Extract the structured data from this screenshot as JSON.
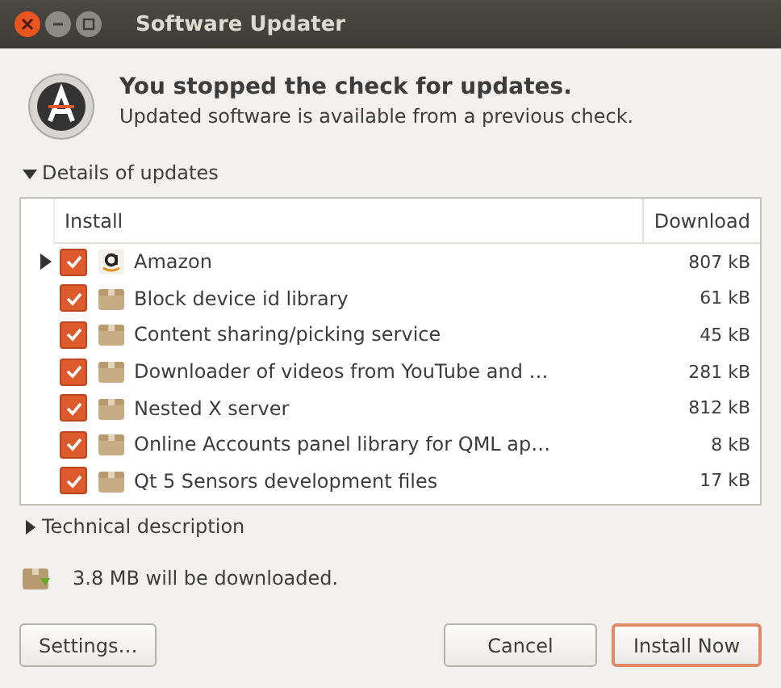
{
  "window": {
    "title": "Software Updater"
  },
  "header": {
    "heading": "You stopped the check for updates.",
    "subtitle": "Updated software is available from a previous check."
  },
  "details": {
    "label": "Details of updates",
    "expanded": true
  },
  "table": {
    "columns": [
      "Install",
      "Download"
    ],
    "rows": [
      {
        "name": "Amazon",
        "size": "807 kB",
        "checked": true,
        "kind": "amazon",
        "expandable": true
      },
      {
        "name": "Block device id library",
        "size": "61 kB",
        "checked": true,
        "kind": "package",
        "expandable": false
      },
      {
        "name": "Content sharing/picking service",
        "size": "45 kB",
        "checked": true,
        "kind": "package",
        "expandable": false
      },
      {
        "name": "Downloader of videos from YouTube and …",
        "size": "281 kB",
        "checked": true,
        "kind": "package",
        "expandable": false
      },
      {
        "name": "Nested X server",
        "size": "812 kB",
        "checked": true,
        "kind": "package",
        "expandable": false
      },
      {
        "name": "Online Accounts panel library for QML ap…",
        "size": "8 kB",
        "checked": true,
        "kind": "package",
        "expandable": false
      },
      {
        "name": "Qt 5 Sensors development files",
        "size": "17 kB",
        "checked": true,
        "kind": "package",
        "expandable": false
      }
    ]
  },
  "technical": {
    "label": "Technical description",
    "expanded": false
  },
  "summary": "3.8 MB will be downloaded.",
  "buttons": [
    {
      "label": "Settings…",
      "kind": "normal"
    },
    {
      "label": "Cancel",
      "kind": "normal"
    },
    {
      "label": "Install Now",
      "kind": "default"
    }
  ]
}
